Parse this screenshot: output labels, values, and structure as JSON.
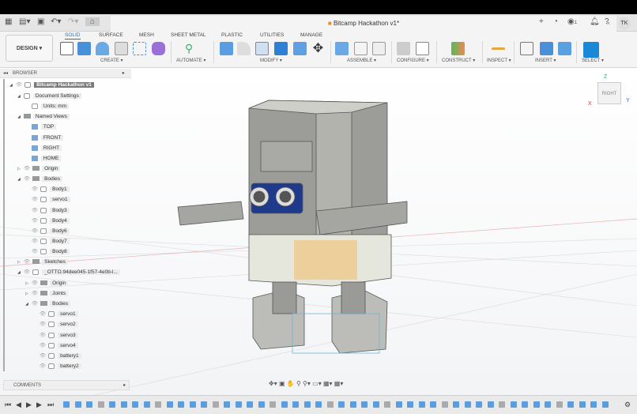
{
  "window": {
    "title": "Bitcamp Hackathon v1*",
    "user_initials": "TK",
    "jobs_count": "1"
  },
  "toolbar": {
    "design_label": "DESIGN ▾",
    "tabs": [
      "SOLID",
      "SURFACE",
      "MESH",
      "SHEET METAL",
      "PLASTIC",
      "UTILITIES",
      "MANAGE"
    ],
    "groups": [
      "CREATE ▾",
      "AUTOMATE ▾",
      "MODIFY ▾",
      "ASSEMBLE ▾",
      "CONFIGURE ▾",
      "CONSTRUCT ▾",
      "INSPECT ▾",
      "INSERT ▾",
      "SELECT ▾"
    ]
  },
  "browser": {
    "title": "BROWSER",
    "items": [
      {
        "label": "Bitcamp Hackathon v1",
        "depth": 0
      },
      {
        "label": "Document Settings",
        "depth": 1
      },
      {
        "label": "Units: mm",
        "depth": 2
      },
      {
        "label": "Named Views",
        "depth": 1
      },
      {
        "label": "TOP",
        "depth": 2
      },
      {
        "label": "FRONT",
        "depth": 2
      },
      {
        "label": "RIGHT",
        "depth": 2
      },
      {
        "label": "HOME",
        "depth": 2
      },
      {
        "label": "Origin",
        "depth": 1
      },
      {
        "label": "Bodies",
        "depth": 1
      },
      {
        "label": "Body1",
        "depth": 2
      },
      {
        "label": "servo1",
        "depth": 2
      },
      {
        "label": "Body3",
        "depth": 2
      },
      {
        "label": "Body4",
        "depth": 2
      },
      {
        "label": "Body6",
        "depth": 2
      },
      {
        "label": "Body7",
        "depth": 2
      },
      {
        "label": "Body8",
        "depth": 2
      },
      {
        "label": "Sketches",
        "depth": 1
      },
      {
        "label": "_OTTO.94dee045-1f57-4e0b-l...",
        "depth": 1
      },
      {
        "label": "Origin",
        "depth": 2
      },
      {
        "label": "Joints",
        "depth": 2
      },
      {
        "label": "Bodies",
        "depth": 2
      },
      {
        "label": "servo1",
        "depth": 3
      },
      {
        "label": "servo2",
        "depth": 3
      },
      {
        "label": "servo3",
        "depth": 3
      },
      {
        "label": "servo4",
        "depth": 3
      },
      {
        "label": "battery1",
        "depth": 3
      },
      {
        "label": "battery2",
        "depth": 3
      }
    ]
  },
  "comments": {
    "title": "COMMENTS"
  },
  "viewcube": {
    "face": "RIGHT",
    "axes": [
      "Z",
      "X",
      "Y"
    ]
  }
}
